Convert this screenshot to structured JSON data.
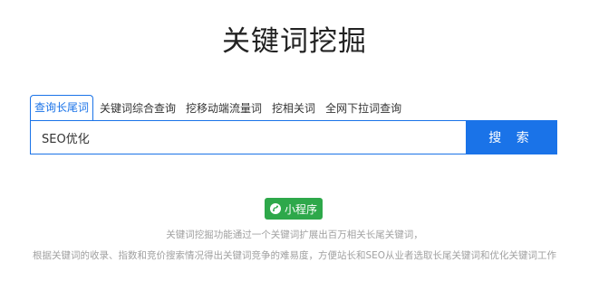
{
  "header": {
    "title": "关键词挖掘"
  },
  "tabs": [
    {
      "label": "查询长尾词",
      "active": true
    },
    {
      "label": "关键词综合查询",
      "active": false
    },
    {
      "label": "挖移动端流量词",
      "active": false
    },
    {
      "label": "挖相关词",
      "active": false
    },
    {
      "label": "全网下拉词查询",
      "active": false
    }
  ],
  "search": {
    "value": "SEO优化",
    "button_label": "搜 索"
  },
  "mini_program": {
    "label": "小程序",
    "icon": "mini-program-icon"
  },
  "description": {
    "line1": "关键词挖掘功能通过一个关键词扩展出百万相关长尾关键词，",
    "line2": "根据关键词的收录、指数和竞价搜索情况得出关键词竞争的难易度，方便站长和SEO从业者选取长尾关键词和优化关键词工作"
  },
  "colors": {
    "accent": "#1a73e8",
    "mini_program": "#2ea84a",
    "muted_text": "#a0a0a0"
  }
}
